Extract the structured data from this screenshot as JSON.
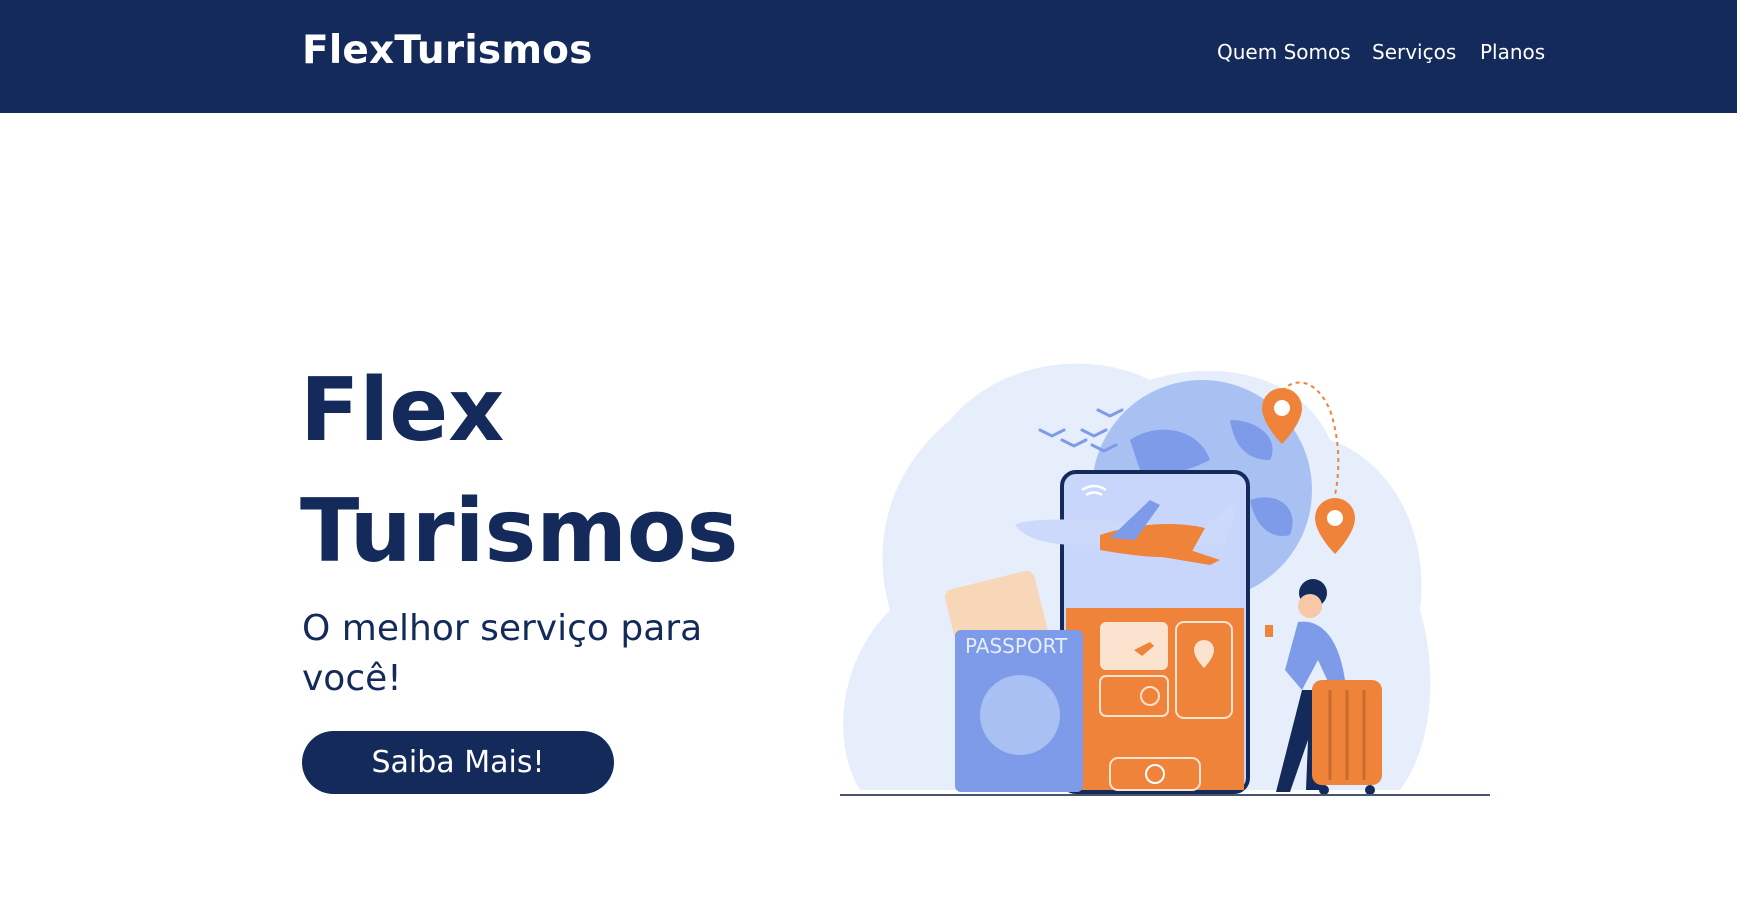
{
  "header": {
    "brand": "FlexTurismos",
    "nav": [
      {
        "label": "Quem Somos"
      },
      {
        "label": "Serviços"
      },
      {
        "label": "Planos"
      }
    ]
  },
  "hero": {
    "title_line1": "Flex",
    "title_line2": "Turismos",
    "subtitle": "O melhor serviço para você!",
    "cta_label": "Saiba Mais!"
  },
  "illustration": {
    "passport_text": "PASSPORT",
    "colors": {
      "navy": "#142a5a",
      "orange": "#f0833a",
      "blue": "#7d9be8",
      "light_blue": "#e6eefb"
    }
  }
}
